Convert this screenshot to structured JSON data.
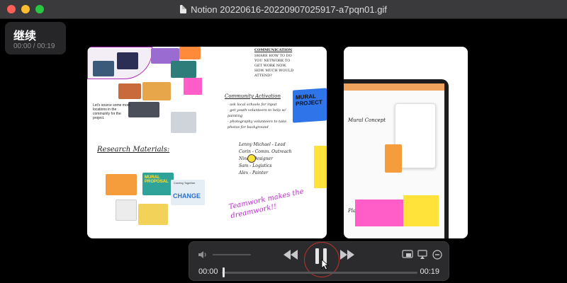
{
  "window": {
    "title": "Notion 20220616-20220907025917-a7pqn01.gif"
  },
  "resume": {
    "label": "继续",
    "time": "00:00 / 00:19"
  },
  "slide": {
    "research": "Research Materials:",
    "lets_source": "Let's source some more locations in the community for the project.",
    "communication": "COMMUNICATION",
    "comm_text": "SHARE HOW TO DO YOU NETWORK TO GET WORK NOW, HOW MUCH WOULD ATTEND?",
    "community_activation": "Community Activation",
    "activation_list": [
      "- ask local schools for input",
      "- get youth volunteers to help w/ painting",
      "- photography volunteers to take photos for background"
    ],
    "team": [
      "Lenny Michael - Lead",
      "Corin - Comm. Outreach",
      "Nina - Designer",
      "Sam - Logistics",
      "Alex - Painter"
    ],
    "mural_project": "MURAL PROJECT",
    "mural_proposal": "MURAL PROPOSAL",
    "change": "CHANGE",
    "coming_together": "Coming Together",
    "teamwork": "Teamwork makes the dreamwork!!",
    "mural_concept": "Mural Concept",
    "plan": "Plan"
  },
  "controls": {
    "time_elapsed": "00:00",
    "time_total": "00:19",
    "progress": 0.0,
    "volume": 0.3
  },
  "colors": {
    "close": "#ff5f57",
    "minimize": "#febc2e",
    "zoom": "#28c840",
    "pink": "#ff5ec8",
    "yellow": "#ffe23a",
    "highlight_ring": "#c0342a"
  }
}
